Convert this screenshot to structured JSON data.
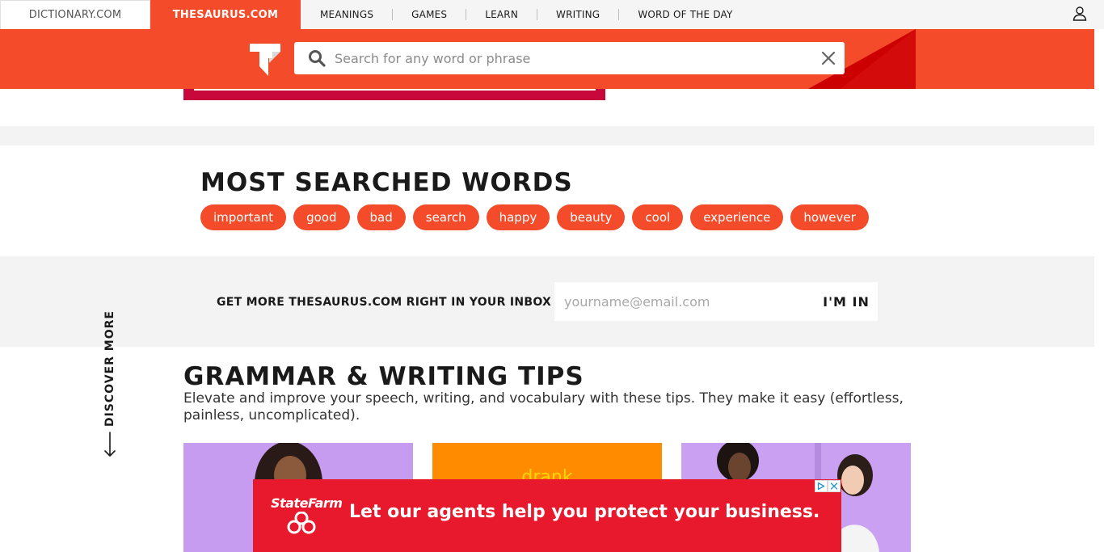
{
  "topnav": {
    "site_tabs": [
      "DICTIONARY.COM",
      "THESAURUS.COM"
    ],
    "menu": [
      "MEANINGS",
      "GAMES",
      "LEARN",
      "WRITING",
      "WORD OF THE DAY"
    ]
  },
  "search": {
    "placeholder": "Search for any word or phrase",
    "value": ""
  },
  "most_searched": {
    "title": "MOST SEARCHED WORDS",
    "words": [
      "important",
      "good",
      "bad",
      "search",
      "happy",
      "beauty",
      "cool",
      "experience",
      "however"
    ]
  },
  "newsletter": {
    "label": "GET MORE THESAURUS.COM RIGHT IN YOUR INBOX",
    "placeholder": "yourname@email.com",
    "button": "I'M IN"
  },
  "discover": {
    "label": "DISCOVER MORE"
  },
  "grammar": {
    "title": "GRAMMAR & WRITING TIPS",
    "description": "Elevate and improve your speech, writing, and vocabulary with these tips. They make it easy (effortless, painless, uncomplicated).",
    "card_word": "drank"
  },
  "ad": {
    "brand": "StateFarm",
    "headline": "Let our agents help you protect your business."
  },
  "colors": {
    "brand": "#f44c2a",
    "brand_dark": "#cc0000",
    "ad_red": "#e8192c"
  },
  "icons": [
    "user-icon",
    "thesaurus-logo",
    "search-icon",
    "close-icon",
    "arrow-down-icon",
    "ad-choices-icon",
    "ad-close-icon"
  ]
}
